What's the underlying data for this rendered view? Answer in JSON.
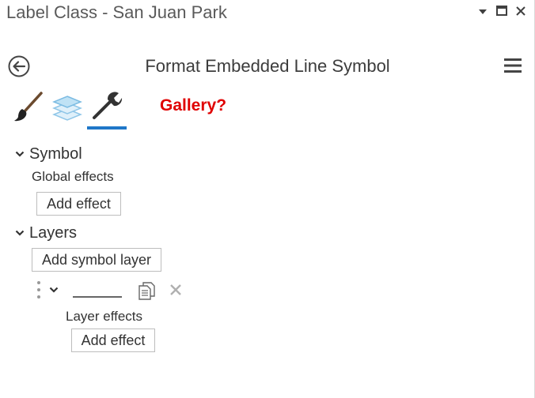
{
  "window": {
    "title": "Label Class - San Juan Park",
    "controls": [
      "pin-icon",
      "maximize-icon",
      "close-icon"
    ]
  },
  "panel": {
    "heading": "Format Embedded Line Symbol",
    "back_icon": "back-arrow-icon",
    "menu_icon": "hamburger-menu-icon"
  },
  "tabs": [
    {
      "icon": "paintbrush-icon",
      "selected": false
    },
    {
      "icon": "layers-icon",
      "selected": false
    },
    {
      "icon": "wrench-icon",
      "selected": true
    }
  ],
  "annotation": "Gallery?",
  "symbol_section": {
    "label": "Symbol",
    "global_effects_label": "Global effects",
    "add_effect_label": "Add effect"
  },
  "layers_section": {
    "label": "Layers",
    "add_symbol_layer_label": "Add symbol layer",
    "layer": {
      "type_icon": "line-symbol-icon",
      "layer_effects_label": "Layer effects",
      "add_effect_label": "Add effect"
    }
  },
  "colors": {
    "accent": "#1f77c8",
    "annotation": "#e00000",
    "text": "#333333",
    "layers_icon": "#8fc6e8"
  }
}
